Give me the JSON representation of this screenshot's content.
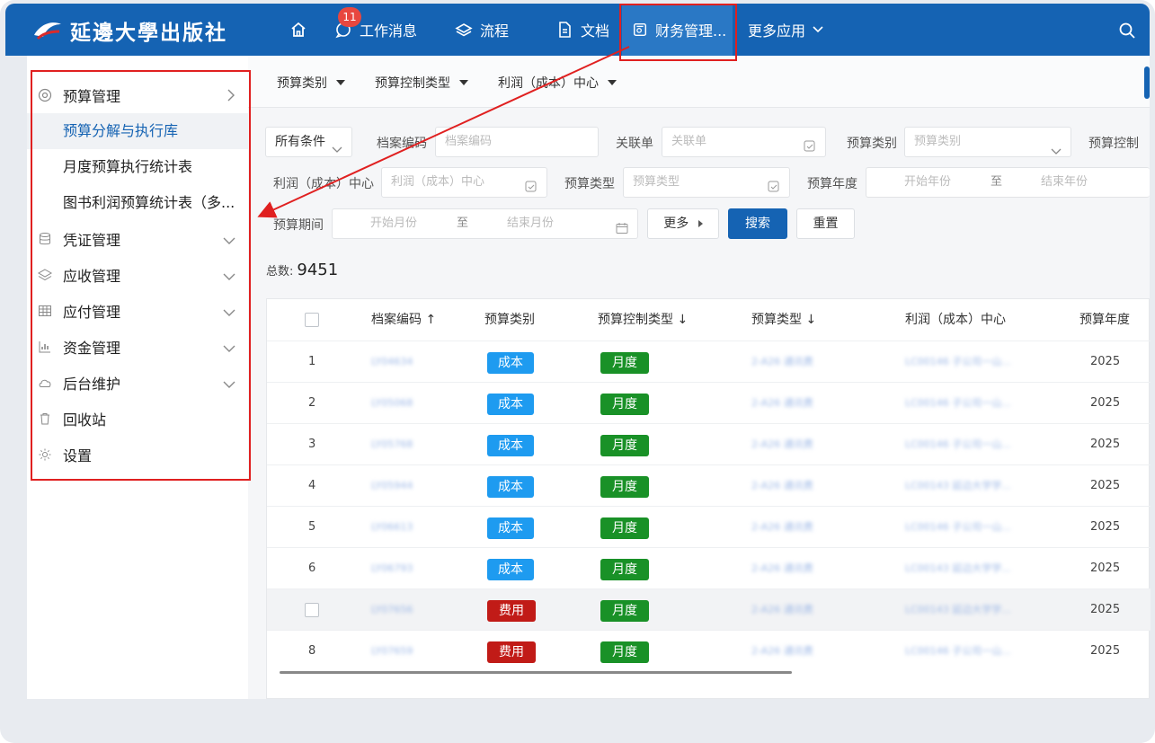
{
  "header": {
    "logo_text": "延邊大學出版社",
    "nav": [
      {
        "label": "",
        "icon": "home-icon"
      },
      {
        "label": "工作消息",
        "icon": "message-icon",
        "badge": "11"
      },
      {
        "label": "流程",
        "icon": "layers-icon"
      },
      {
        "label": "文档",
        "icon": "document-icon"
      },
      {
        "label": "财务管理...",
        "icon": "finance-icon"
      },
      {
        "label": "更多应用",
        "icon": "chevron-down-icon"
      }
    ],
    "colors": {
      "bar": "#1563b3",
      "active": "#2a78c5"
    }
  },
  "sidebar": {
    "items": [
      {
        "label": "预算管理",
        "icon": "at-icon",
        "chevron": ">"
      },
      {
        "label": "预算分解与执行库",
        "sub": true,
        "active": true
      },
      {
        "label": "月度预算执行统计表",
        "sub": true
      },
      {
        "label": "图书利润预算统计表（多...",
        "sub": true
      },
      {
        "label": "凭证管理",
        "icon": "database-icon"
      },
      {
        "label": "应收管理",
        "icon": "layers-icon"
      },
      {
        "label": "应付管理",
        "icon": "table-icon"
      },
      {
        "label": "资金管理",
        "icon": "bar-chart-icon"
      },
      {
        "label": "后台维护",
        "icon": "cloud-icon"
      },
      {
        "label": "回收站",
        "icon": "trash-icon"
      },
      {
        "label": "设置",
        "icon": "gear-icon"
      }
    ]
  },
  "tabs": [
    "预算类别",
    "预算控制类型",
    "利润（成本）中心"
  ],
  "filters": {
    "conditions_select": "所有条件",
    "archive_no_label": "档案编码",
    "archive_no_placeholder": "档案编码",
    "related_label": "关联单",
    "related_placeholder": "关联单",
    "budget_category_label": "预算类别",
    "budget_category_placeholder": "预算类别",
    "budget_control_label": "预算控制",
    "profit_center_label": "利润（成本）中心",
    "profit_center_placeholder": "利润（成本）中心",
    "budget_type_label": "预算类型",
    "budget_type_placeholder": "预算类型",
    "budget_year_label": "预算年度",
    "start_year": "开始年份",
    "to": "至",
    "end_year": "结束年份",
    "budget_period_label": "预算期间",
    "start_month": "开始月份",
    "end_month": "结束月份",
    "more_button": "更多",
    "search_button": "搜索",
    "reset_button": "重置"
  },
  "summary": {
    "total_label": "总数:",
    "total_value": "9451"
  },
  "table": {
    "headers": [
      "档案编码 ↑",
      "预算类别",
      "预算控制类型 ↓",
      "预算类型 ↓",
      "利润（成本）中心",
      "预算年度"
    ],
    "rows": [
      {
        "no": "1",
        "code": "LY04634",
        "category": "成本",
        "control": "月度",
        "type": "2-A26 通讯费",
        "center": "LC00146 子公司一山...",
        "year": "2025"
      },
      {
        "no": "2",
        "code": "LY05068",
        "category": "成本",
        "control": "月度",
        "type": "2-A26 通讯费",
        "center": "LC00146 子公司一山...",
        "year": "2025"
      },
      {
        "no": "3",
        "code": "LY05768",
        "category": "成本",
        "control": "月度",
        "type": "2-A26 通讯费",
        "center": "LC00146 子公司一山...",
        "year": "2025"
      },
      {
        "no": "4",
        "code": "LY05944",
        "category": "成本",
        "control": "月度",
        "type": "2-A26 通讯费",
        "center": "LC00143 延边大学学...",
        "year": "2025"
      },
      {
        "no": "5",
        "code": "LY06613",
        "category": "成本",
        "control": "月度",
        "type": "2-A26 通讯费",
        "center": "LC00146 子公司一山...",
        "year": "2025"
      },
      {
        "no": "6",
        "code": "LY06793",
        "category": "成本",
        "control": "月度",
        "type": "2-A26 通讯费",
        "center": "LC00143 延边大学学...",
        "year": "2025"
      },
      {
        "no": "",
        "code": "LY07656",
        "category": "费用",
        "control": "月度",
        "type": "2-A26 通讯费",
        "center": "LC00143 延边大学学...",
        "year": "2025"
      },
      {
        "no": "8",
        "code": "LY07659",
        "category": "费用",
        "control": "月度",
        "type": "2-A26 通讯费",
        "center": "LC00146 子公司一山...",
        "year": "2025"
      }
    ],
    "tag_colors": {
      "成本": "#1e9bf0",
      "费用": "#c11b17",
      "月度": "#199127"
    }
  },
  "annotation": {
    "color": "#e02020"
  }
}
